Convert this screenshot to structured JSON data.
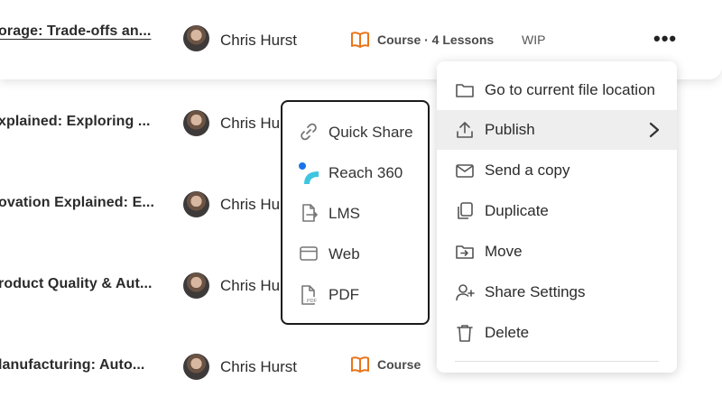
{
  "rows": [
    {
      "title": "orage: Trade-offs an...",
      "author": "Chris Hurst",
      "course": "Course · 4 Lessons",
      "status": "WIP",
      "more": "•••"
    },
    {
      "title": "xplained: Exploring ...",
      "author": "Chris Hu"
    },
    {
      "title": "ovation Explained: E...",
      "author": "Chris Hu"
    },
    {
      "title": "roduct Quality & Aut...",
      "author": "Chris Hu"
    },
    {
      "title": "lanufacturing: Auto...",
      "author": "Chris Hurst",
      "course": "Course"
    }
  ],
  "context_menu": {
    "items": [
      {
        "label": "Go to current file location",
        "icon": "folder-icon"
      },
      {
        "label": "Publish",
        "icon": "upload-icon",
        "active": true
      },
      {
        "label": "Send a copy",
        "icon": "mail-icon"
      },
      {
        "label": "Duplicate",
        "icon": "duplicate-icon"
      },
      {
        "label": "Move",
        "icon": "move-icon"
      },
      {
        "label": "Share Settings",
        "icon": "add-user-icon"
      },
      {
        "label": "Delete",
        "icon": "trash-icon"
      }
    ]
  },
  "publish_submenu": {
    "items": [
      {
        "label": "Quick Share",
        "icon": "link-icon"
      },
      {
        "label": "Reach 360",
        "icon": "reach-360-logo-icon"
      },
      {
        "label": "LMS",
        "icon": "lms-file-icon"
      },
      {
        "label": "Web",
        "icon": "browser-window-icon"
      },
      {
        "label": "PDF",
        "icon": "pdf-file-icon"
      }
    ]
  },
  "colors": {
    "accent_orange": "#e8751a",
    "reach_blue": "#1a73e8",
    "reach_teal": "#3ec6e0"
  }
}
